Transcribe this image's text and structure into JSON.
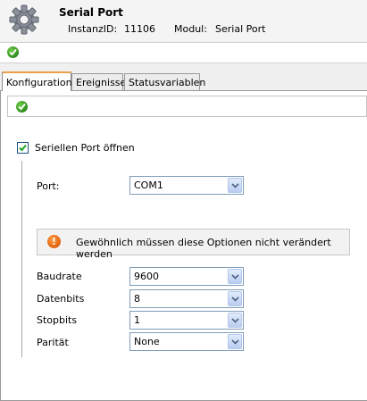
{
  "header": {
    "title": "Serial Port",
    "instance_label": "InstanzID:",
    "instance_id": "11106",
    "module_label": "Modul:",
    "module_name": "Serial Port",
    "icon": "gear-icon"
  },
  "tabs": [
    {
      "label": "Konfiguration",
      "active": true
    },
    {
      "label": "Ereignisse",
      "active": false
    },
    {
      "label": "Statusvariablen",
      "active": false
    }
  ],
  "config": {
    "open_port_label": "Seriellen Port öffnen",
    "open_port_checked": true,
    "port": {
      "label": "Port:",
      "value": "COM1"
    },
    "notice": "Gewöhnlich müssen diese Optionen nicht verändert werden",
    "baudrate": {
      "label": "Baudrate",
      "value": "9600"
    },
    "databits": {
      "label": "Datenbits",
      "value": "8"
    },
    "stopbits": {
      "label": "Stopbits",
      "value": "1"
    },
    "parity": {
      "label": "Parität",
      "value": "None"
    }
  },
  "colors": {
    "ok": "#2e8b1e",
    "warning": "#e0610c",
    "active_tab_accent": "#e8a24a"
  }
}
